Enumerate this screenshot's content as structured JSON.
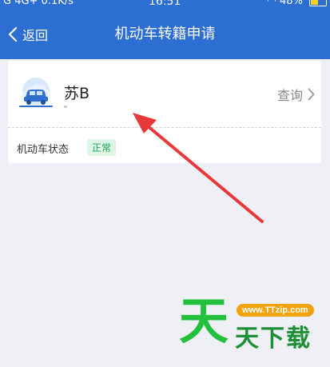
{
  "status_bar": {
    "signal_text": "G 4G+",
    "speed": "0.1K/s",
    "time": "16:51",
    "battery": "48%"
  },
  "header": {
    "back_label": "返回",
    "title": "机动车转籍申请"
  },
  "vehicle_card": {
    "plate": "苏B",
    "query_label": "查询",
    "status_label": "机动车状态",
    "status_value": "正常"
  },
  "watermark": {
    "big_glyph": "天",
    "url": "www.TTzip.com",
    "site_name": "天下载"
  },
  "colors": {
    "header_bg": "#2d6ed3",
    "page_bg": "#eef0f5",
    "status_green": "#1aaa55",
    "arrow_red": "#e8383a"
  }
}
